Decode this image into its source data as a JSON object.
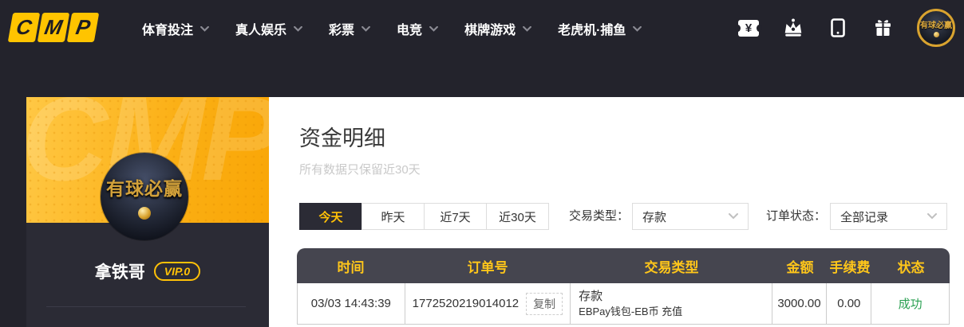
{
  "brand": {
    "letters": [
      "C",
      "M",
      "P"
    ]
  },
  "nav": {
    "items": [
      {
        "label": "体育投注"
      },
      {
        "label": "真人娱乐"
      },
      {
        "label": "彩票"
      },
      {
        "label": "电竞"
      },
      {
        "label": "棋牌游戏"
      },
      {
        "label": "老虎机·捕鱼"
      }
    ]
  },
  "header_icons": {
    "voucher": "yen-voucher-icon",
    "voucher_glyph": "¥",
    "crown": "crown-icon",
    "mobile": "mobile-app-icon",
    "gift": "gift-icon",
    "avatar": "user-avatar"
  },
  "profile": {
    "username": "拿铁哥",
    "vip_badge": "VIP.0",
    "avatar_text": "有球必赢",
    "watermark": "CMP"
  },
  "page": {
    "title": "资金明细",
    "subtitle": "所有数据只保留近30天"
  },
  "filters": {
    "tabs": [
      {
        "label": "今天",
        "active": true
      },
      {
        "label": "昨天",
        "active": false
      },
      {
        "label": "近7天",
        "active": false
      },
      {
        "label": "近30天",
        "active": false
      }
    ],
    "transaction_type_label": "交易类型：",
    "transaction_type_value": "存款",
    "order_status_label": "订单状态：",
    "order_status_value": "全部记录"
  },
  "table": {
    "columns": [
      "时间",
      "订单号",
      "交易类型",
      "金额",
      "手续费",
      "状态"
    ],
    "rows": [
      {
        "time": "03/03 14:43:39",
        "order_no": "1772520219014012",
        "copy_label": "复制",
        "type_line1": "存款",
        "type_line2": "EBPay钱包-EB币 充值",
        "amount": "3000.00",
        "fee": "0.00",
        "status": "成功"
      }
    ]
  },
  "colors": {
    "accent_yellow": "#ffc107",
    "brand_yellow": "#ffc400",
    "dark_bg": "#23232c",
    "card_dark": "#2b2b35",
    "table_header_bg": "#45454f",
    "success_green": "#2aa052",
    "orange_gradient_start": "#ffc845",
    "orange_gradient_end": "#f9a606"
  }
}
